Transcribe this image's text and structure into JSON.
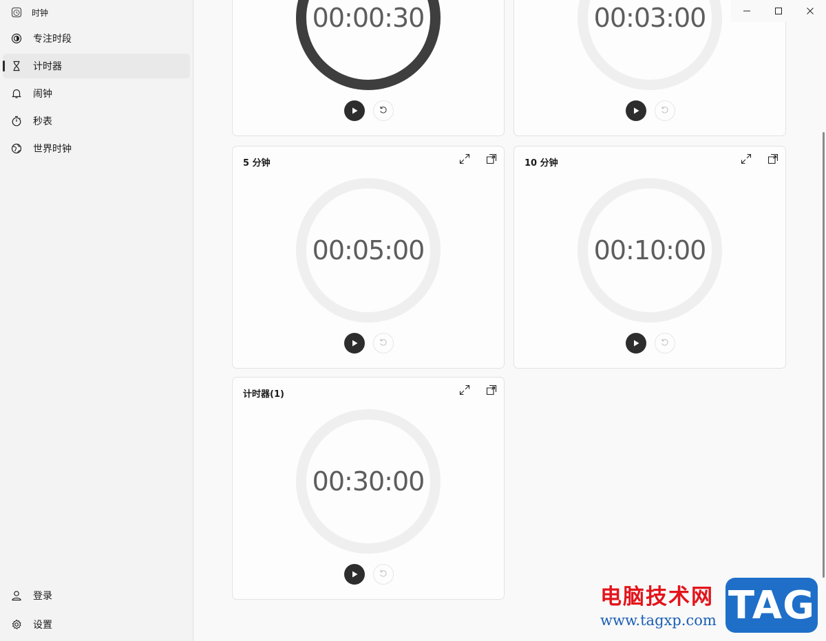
{
  "app": {
    "title": "时钟",
    "title_icon": "clock-app-icon"
  },
  "sidebar": {
    "items": [
      {
        "label": "专注时段",
        "icon": "focus-icon",
        "active": false
      },
      {
        "label": "计时器",
        "icon": "hourglass-icon",
        "active": true
      },
      {
        "label": "闹钟",
        "icon": "bell-icon",
        "active": false
      },
      {
        "label": "秒表",
        "icon": "stopwatch-icon",
        "active": false
      },
      {
        "label": "世界时钟",
        "icon": "globe-icon",
        "active": false
      }
    ],
    "bottom": [
      {
        "label": "登录",
        "icon": "person-icon"
      },
      {
        "label": "设置",
        "icon": "gear-icon"
      }
    ]
  },
  "window": {
    "controls": [
      "minimize-icon",
      "maximize-icon",
      "close-icon"
    ]
  },
  "timers": [
    {
      "title": "",
      "time": "00:00:30",
      "running": true
    },
    {
      "title": "",
      "time": "00:03:00",
      "running": false
    },
    {
      "title": "5 分钟",
      "time": "00:05:00",
      "running": false
    },
    {
      "title": "10 分钟",
      "time": "00:10:00",
      "running": false
    },
    {
      "title": "计时器(1)",
      "time": "00:30:00",
      "running": false
    }
  ],
  "watermark": {
    "site_name": "电脑技术网",
    "url": "www.tagxp.com",
    "logo_text": "TAG"
  },
  "colors": {
    "accent_dark": "#2d2d2d",
    "ring_running": "#3e3e3e",
    "ring_idle": "#efefef",
    "watermark_red": "#e3141b",
    "watermark_blue": "#1f6fc9"
  }
}
